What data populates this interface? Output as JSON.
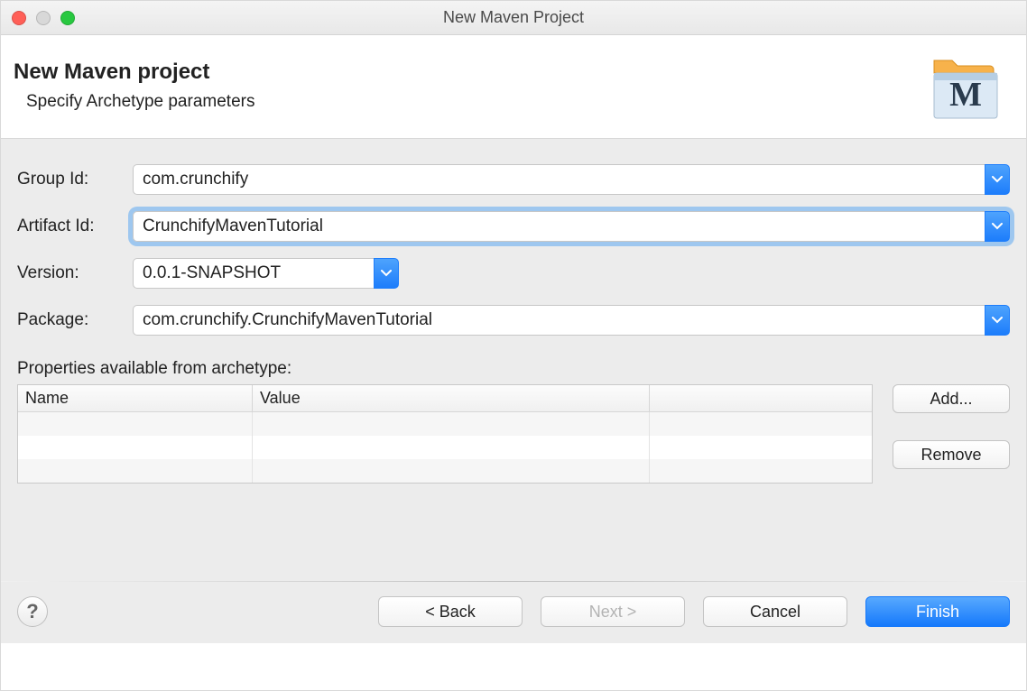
{
  "window": {
    "title": "New Maven Project"
  },
  "banner": {
    "title": "New Maven project",
    "subtitle": "Specify Archetype parameters"
  },
  "form": {
    "labels": {
      "group_id": "Group Id:",
      "artifact_id": "Artifact Id:",
      "version": "Version:",
      "package": "Package:"
    },
    "group_id": "com.crunchify",
    "artifact_id": "CrunchifyMavenTutorial",
    "version": "0.0.1-SNAPSHOT",
    "package": "com.crunchify.CrunchifyMavenTutorial"
  },
  "properties": {
    "label": "Properties available from archetype:",
    "columns": {
      "name": "Name",
      "value": "Value"
    },
    "rows": [
      {
        "name": "",
        "value": ""
      },
      {
        "name": "",
        "value": ""
      },
      {
        "name": "",
        "value": ""
      }
    ],
    "buttons": {
      "add": "Add...",
      "remove": "Remove"
    }
  },
  "footer": {
    "back": "< Back",
    "next": "Next >",
    "cancel": "Cancel",
    "finish": "Finish"
  },
  "colors": {
    "accent": "#1d7dfb",
    "focus_ring": "#9ec7ef",
    "bg_panel": "#ececec"
  }
}
